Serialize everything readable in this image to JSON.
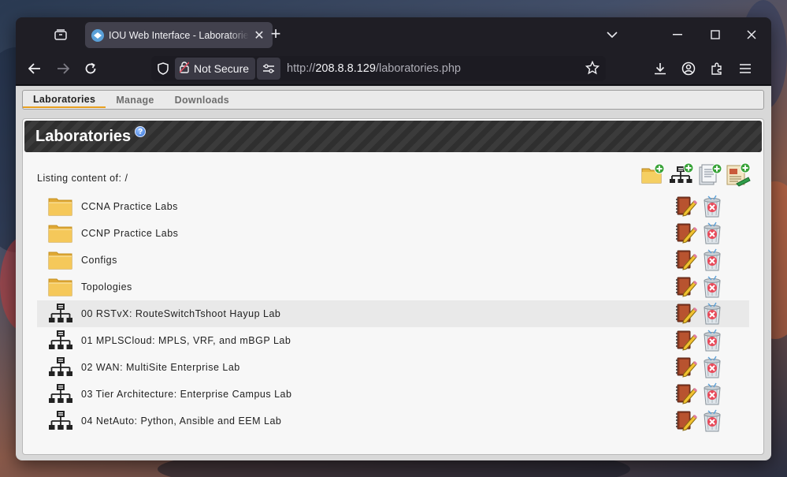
{
  "browser": {
    "tab_title": "IOU Web Interface - Laboratories",
    "security_label": "Not Secure",
    "url_prefix": "http://",
    "url_host": "208.8.8.129",
    "url_path": "/laboratories.php"
  },
  "menu": {
    "items": [
      {
        "label": "Laboratories",
        "active": true
      },
      {
        "label": "Manage",
        "active": false
      },
      {
        "label": "Downloads",
        "active": false
      }
    ]
  },
  "panel": {
    "title": "Laboratories",
    "help_glyph": "?",
    "listing_label": "Listing content of: /"
  },
  "entries": [
    {
      "type": "folder",
      "name": "CCNA Practice Labs"
    },
    {
      "type": "folder",
      "name": "CCNP Practice Labs"
    },
    {
      "type": "folder",
      "name": "Configs"
    },
    {
      "type": "folder",
      "name": "Topologies"
    },
    {
      "type": "lab",
      "name": "00 RSTvX: RouteSwitchTshoot Hayup Lab",
      "highlighted": true
    },
    {
      "type": "lab",
      "name": "01 MPLSCloud: MPLS, VRF, and mBGP Lab"
    },
    {
      "type": "lab",
      "name": "02 WAN: MultiSite Enterprise Lab"
    },
    {
      "type": "lab",
      "name": "03 Tier Architecture: Enterprise Campus Lab"
    },
    {
      "type": "lab",
      "name": "04 NetAuto: Python, Ansible and EEM Lab"
    }
  ],
  "icons": {
    "toolbar": [
      "add-folder-icon",
      "add-lab-icon",
      "add-config-icon",
      "import-icon"
    ],
    "row_actions": [
      "edit-icon",
      "delete-icon"
    ]
  },
  "colors": {
    "menu_active_underline": "#e8a020",
    "header_dark": "#2f2f2f",
    "folder_yellow": "#f2c14e"
  }
}
